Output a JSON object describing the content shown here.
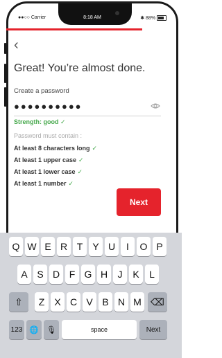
{
  "status": {
    "carrier": "●●○○ Carrier",
    "time": "8:18 AM",
    "battery": "88%"
  },
  "colors": {
    "accent": "#e5232c",
    "success": "#44a84a"
  },
  "progress": {
    "value": 0.86
  },
  "nav": {
    "back": "‹"
  },
  "title": "Great! You’re almost done.",
  "password": {
    "label": "Create a password",
    "value": "●●●●●●●●●●",
    "toggle_icon": "eye-icon"
  },
  "strength": "Strength: good ✓",
  "requirements_label": "Password must contain :",
  "requirements": [
    {
      "text": "At least 8 characters long",
      "check": "✓"
    },
    {
      "text": "At least 1 upper case",
      "check": "✓"
    },
    {
      "text": "At least 1 lower case",
      "check": "✓"
    },
    {
      "text": "At least 1 number",
      "check": "✓"
    }
  ],
  "next_button": "Next",
  "keyboard": {
    "row1": [
      "Q",
      "W",
      "E",
      "R",
      "T",
      "Y",
      "U",
      "I",
      "O",
      "P"
    ],
    "row2": [
      "A",
      "S",
      "D",
      "F",
      "G",
      "H",
      "J",
      "K",
      "L"
    ],
    "row3": [
      "Z",
      "X",
      "C",
      "V",
      "B",
      "N",
      "M"
    ],
    "shift": "⇧",
    "delete": "⌫",
    "numbers": "123",
    "globe": "🌐",
    "mic": "🎙",
    "space": "space",
    "next": "Next"
  }
}
